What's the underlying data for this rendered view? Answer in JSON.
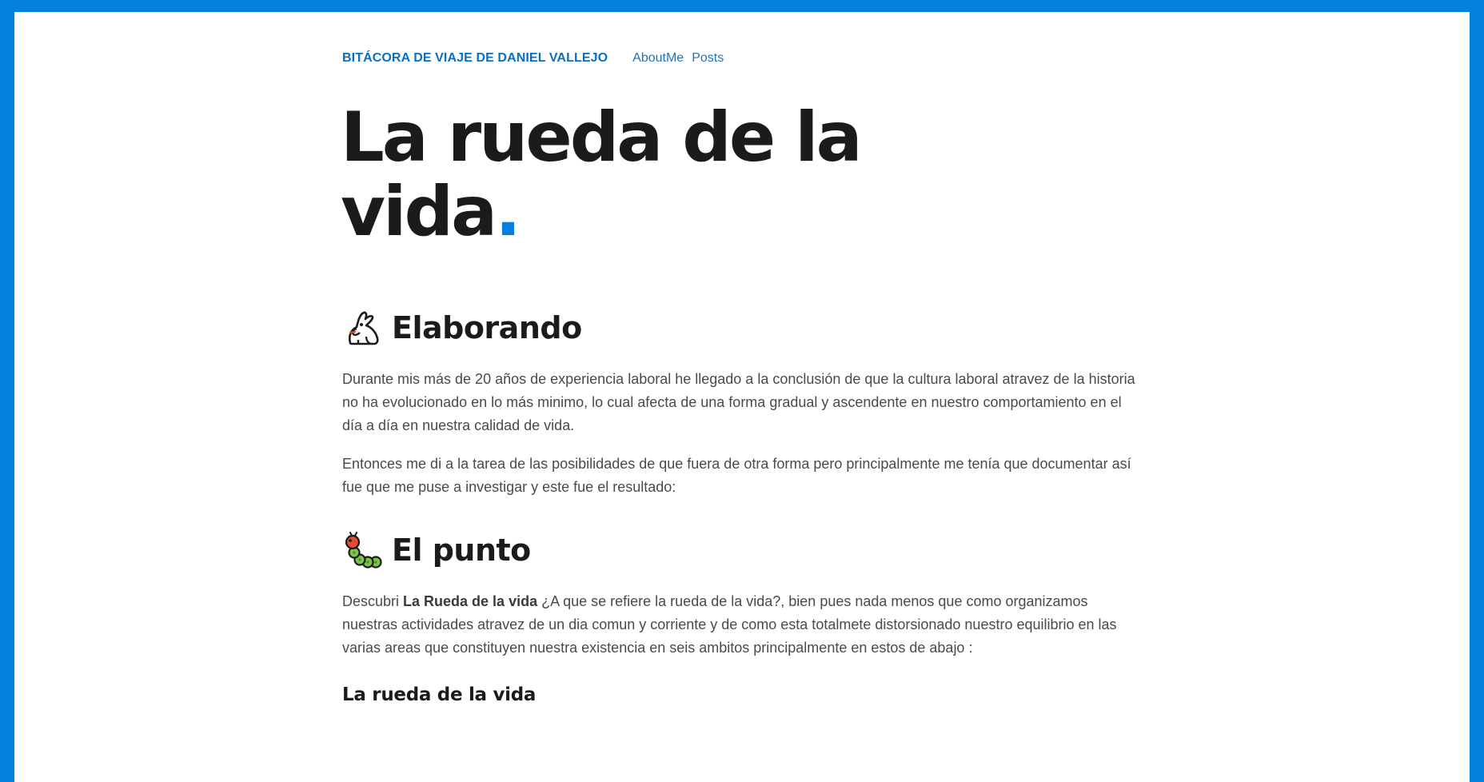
{
  "header": {
    "site_title": "BITÁCORA DE VIAJE DE DANIEL VALLEJO",
    "nav": [
      {
        "label": "AboutMe"
      },
      {
        "label": "Posts"
      }
    ]
  },
  "page": {
    "title_line1": "La rueda de la",
    "title_line2": "vida",
    "title_dot": ".",
    "accent_color": "#0280dd"
  },
  "sections": [
    {
      "icon": "rabbit-icon",
      "heading": "Elaborando",
      "paragraphs": [
        "Durante mis más de 20 años de experiencia laboral he llegado a la conclusión de que la cultura laboral atravez de la historia no ha evolucionado en lo más minimo, lo cual afecta de una forma gradual y ascendente en nuestro comportamiento en el día a día en nuestra calidad de vida.",
        "Entonces me di a la tarea de las posibilidades de que fuera de otra forma pero principalmente me tenía que documentar así fue que me puse a investigar y este fue el resultado:"
      ]
    },
    {
      "icon": "caterpillar-icon",
      "heading": "El punto",
      "paragraph": {
        "before": "Descubri ",
        "bold": "La Rueda de la vida",
        "after": " ¿A que se refiere la rueda de la vida?, bien pues nada menos que como organizamos nuestras actividades atravez de un dia comun y corriente y de como esta totalmete distorsionado nuestro equilibrio en las varias areas que constituyen nuestra existencia en seis ambitos principalmente en estos de abajo :"
      },
      "subheading": "La rueda de la vida"
    }
  ]
}
